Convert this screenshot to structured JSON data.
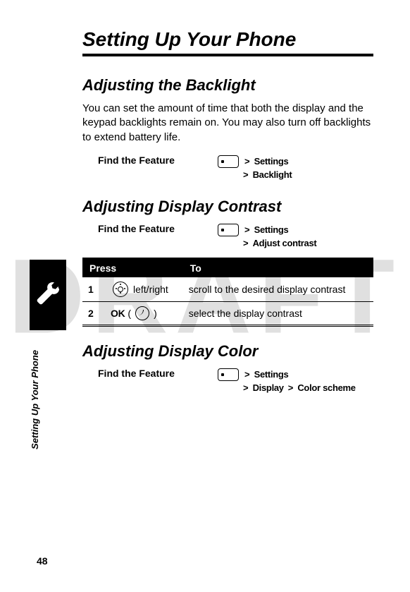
{
  "watermark": "DRAFT",
  "chapter_title": "Setting Up Your Phone",
  "side_label": "Setting Up Your Phone",
  "page_number": "48",
  "s1": {
    "title": "Adjusting the Backlight",
    "body": "You can set the amount of time that both the display and the keypad backlights remain on. You may also turn off backlights to extend battery life.",
    "feature_label": "Find the Feature",
    "path": [
      "Settings",
      "Backlight"
    ]
  },
  "s2": {
    "title": "Adjusting Display Contrast",
    "feature_label": "Find the Feature",
    "path": [
      "Settings",
      "Adjust contrast"
    ],
    "table": {
      "h1": "Press",
      "h2": "To",
      "r1": {
        "n": "1",
        "press": "left/right",
        "to": "scroll to the desired display contrast"
      },
      "r2": {
        "n": "2",
        "ok": "OK",
        "press": "(",
        "press2": ")",
        "to": "select the display contrast"
      }
    }
  },
  "s3": {
    "title": "Adjusting Display Color",
    "feature_label": "Find the Feature",
    "path": [
      "Settings",
      "Display",
      "Color scheme"
    ]
  }
}
